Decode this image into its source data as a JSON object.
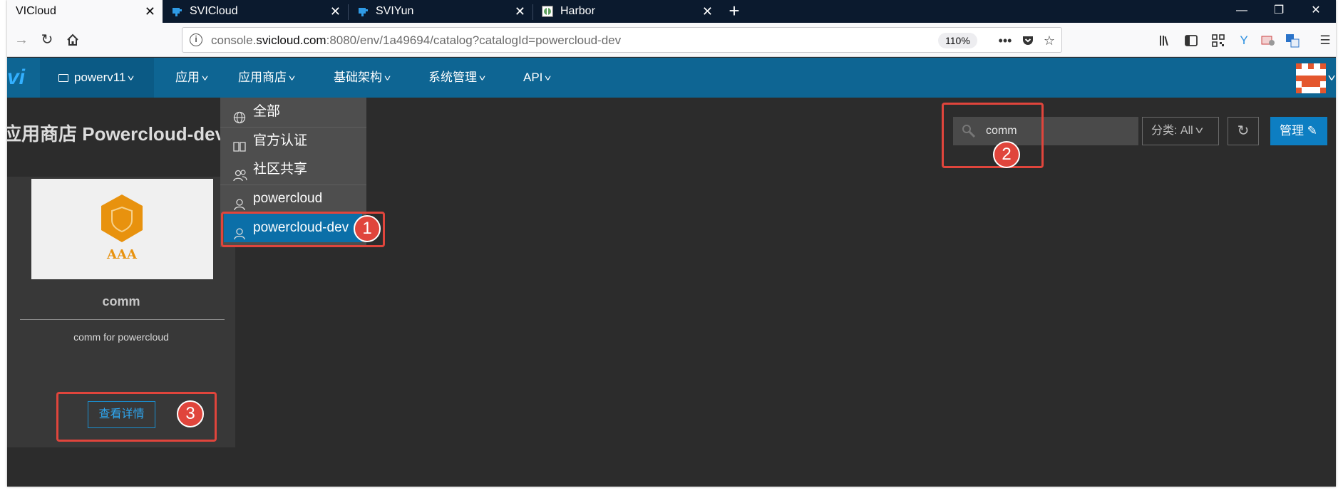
{
  "browser": {
    "tabs": [
      {
        "title": "VICloud",
        "active": true
      },
      {
        "title": "SVICloud",
        "active": false
      },
      {
        "title": "SVIYun",
        "active": false
      },
      {
        "title": "Harbor",
        "active": false
      }
    ],
    "url_prefix": "console.",
    "url_domain": "svicloud.com",
    "url_rest": ":8080/env/1a49694/catalog?catalogId=powercloud-dev",
    "zoom": "110%"
  },
  "app": {
    "brand": "vi",
    "env": "powerv11",
    "menus": [
      "应用",
      "应用商店",
      "基础架构",
      "系统管理",
      "API"
    ]
  },
  "catalog_dropdown": {
    "items": [
      {
        "label": "全部",
        "icon": "globe-icon"
      },
      {
        "label": "官方认证",
        "icon": "book-icon"
      },
      {
        "label": "社区共享",
        "icon": "users-icon"
      },
      {
        "label": "powercloud",
        "icon": "user-icon"
      },
      {
        "label": "powercloud-dev",
        "icon": "user-icon",
        "selected": true
      }
    ]
  },
  "page": {
    "title": "应用商店 Powercloud-dev"
  },
  "toolbar": {
    "search_value": "comm",
    "category_label": "分类: All",
    "manage_label": "管理"
  },
  "card": {
    "name": "comm",
    "description": "comm for powercloud",
    "logo_text": "AAA",
    "detail_label": "查看详情"
  },
  "annotations": [
    "1",
    "2",
    "3"
  ],
  "colors": {
    "header": "#0e6593",
    "accent": "#0d7ec2",
    "annotation": "#e0453c",
    "background": "#2c2c2c"
  }
}
